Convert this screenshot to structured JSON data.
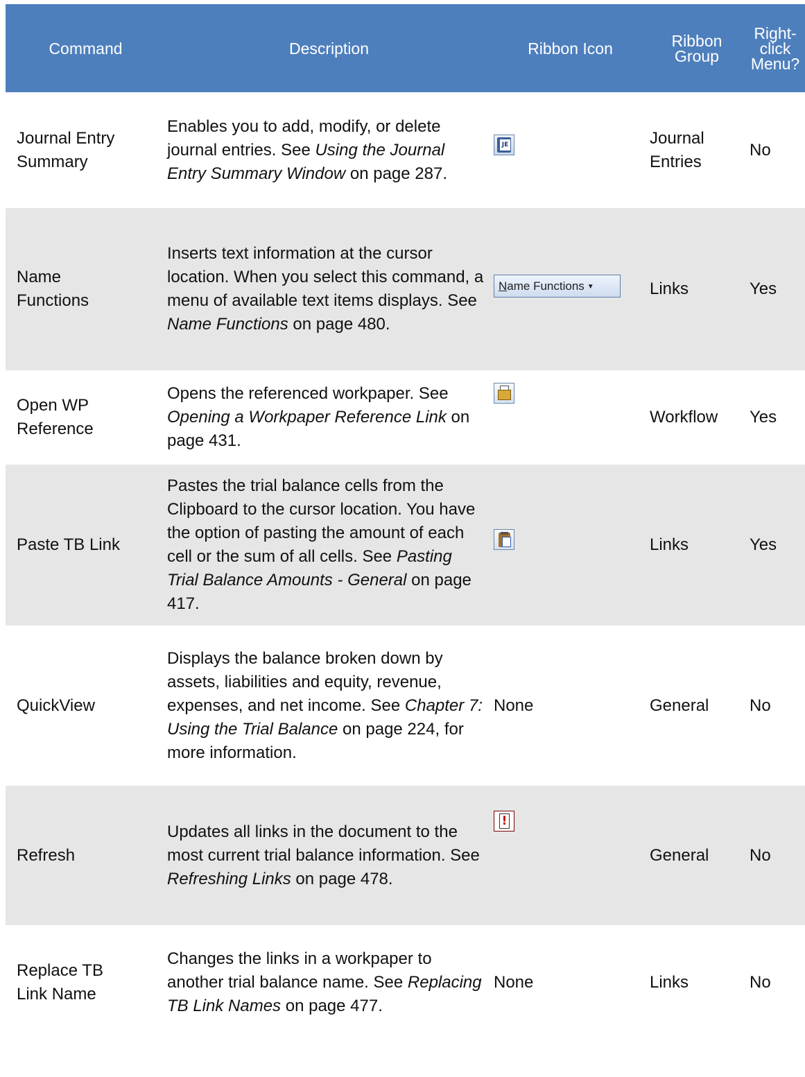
{
  "headers": {
    "command": "Command",
    "description": "Description",
    "ribbon_icon": "Ribbon Icon",
    "ribbon_group_1": "Ribbon",
    "ribbon_group_2": "Group",
    "right_click_1": "Right-",
    "right_click_2": "click",
    "right_click_3": "Menu?"
  },
  "rows": [
    {
      "command_1": "Journal Entry",
      "command_2": "Summary",
      "desc_a": "Enables you to add, modify, or delete journal entries. See ",
      "desc_link": "Using the Journal Entry Summary Window",
      "desc_b": " on page 287.",
      "icon": "journal-entry-icon",
      "group_1": "Journal",
      "group_2": "Entries",
      "right_click": "No"
    },
    {
      "command_1": "Name",
      "command_2": "Functions",
      "desc_a": "Inserts text information at the cursor location. When you select this command, a menu of available text items displays. See ",
      "desc_link": "Name Functions",
      "desc_b": " on page 480.",
      "icon": "name-functions-dropdown",
      "icon_label_first": "N",
      "icon_label_rest": "ame Functions",
      "icon_arrow": "▼",
      "group_1": "Links",
      "right_click": "Yes"
    },
    {
      "command_1": "Open WP",
      "command_2": "Reference",
      "desc_a": "Opens the referenced workpaper. See ",
      "desc_link": "Opening a Workpaper Reference Link",
      "desc_b": " on page 431.",
      "icon": "open-folder-icon",
      "group_1": "Workflow",
      "right_click": "Yes"
    },
    {
      "command_1": "Paste TB Link",
      "desc_a": "Pastes the trial balance cells from the Clipboard to the cursor location. You have the option of pasting the amount of each cell or the sum of all cells. See ",
      "desc_link": "Pasting Trial Balance Amounts - General",
      "desc_b": " on page 417.",
      "icon": "paste-icon",
      "group_1": "Links",
      "right_click": "Yes"
    },
    {
      "command_1": "QuickView",
      "desc_a": "Displays the balance broken down by assets, liabilities and equity, revenue, expenses, and net income. See ",
      "desc_link": "Chapter 7: Using the Trial Balance",
      "desc_b": " on page 224, for more information.",
      "icon_text": "None",
      "group_1": "General",
      "right_click": "No"
    },
    {
      "command_1": "Refresh",
      "desc_a": "Updates all links in the document to the most current trial balance information. See ",
      "desc_link": "Refreshing Links",
      "desc_b": " on page 478.",
      "icon": "refresh-icon",
      "group_1": "General",
      "right_click": "No"
    },
    {
      "command_1": "Replace TB",
      "command_2": "Link Name",
      "desc_a": "Changes the links in a workpaper to another trial balance name. See ",
      "desc_link": "Replacing TB Link Names",
      "desc_b": " on page 477.",
      "icon_text": "None",
      "group_1": "Links",
      "right_click": "No"
    }
  ],
  "colors": {
    "header_bg": "#4e7fbd",
    "header_text": "#ffffff",
    "row_alt_bg": "#e6e6e6"
  }
}
